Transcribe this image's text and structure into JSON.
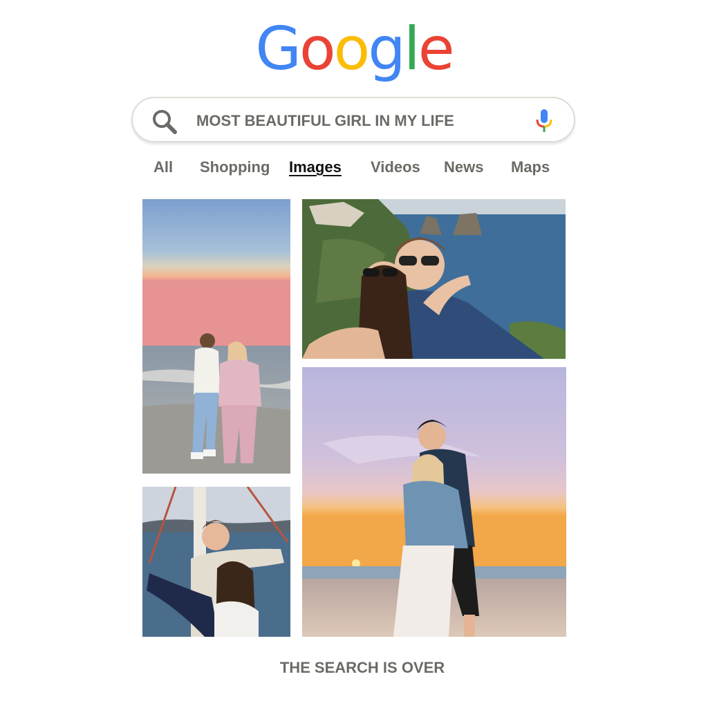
{
  "logo": {
    "letters": [
      {
        "char": "G",
        "color": "#4285F4"
      },
      {
        "char": "o",
        "color": "#EA4335"
      },
      {
        "char": "o",
        "color": "#FBBC05"
      },
      {
        "char": "g",
        "color": "#4285F4"
      },
      {
        "char": "l",
        "color": "#34A853"
      },
      {
        "char": "e",
        "color": "#EA4335"
      }
    ]
  },
  "search": {
    "query": "MOST BEAUTIFUL GIRL IN MY LIFE",
    "search_icon": "search-icon",
    "mic_icon": "microphone-icon"
  },
  "tabs": [
    {
      "label": "All",
      "active": false
    },
    {
      "label": "Shopping",
      "active": false
    },
    {
      "label": "Images",
      "active": true
    },
    {
      "label": "Videos",
      "active": false
    },
    {
      "label": "News",
      "active": false
    },
    {
      "label": "Maps",
      "active": false
    }
  ],
  "caption": "THE SEARCH IS OVER",
  "colors": {
    "text_gray": "#6b6b66",
    "active_tab": "#111111",
    "border": "#dcdcd6"
  }
}
